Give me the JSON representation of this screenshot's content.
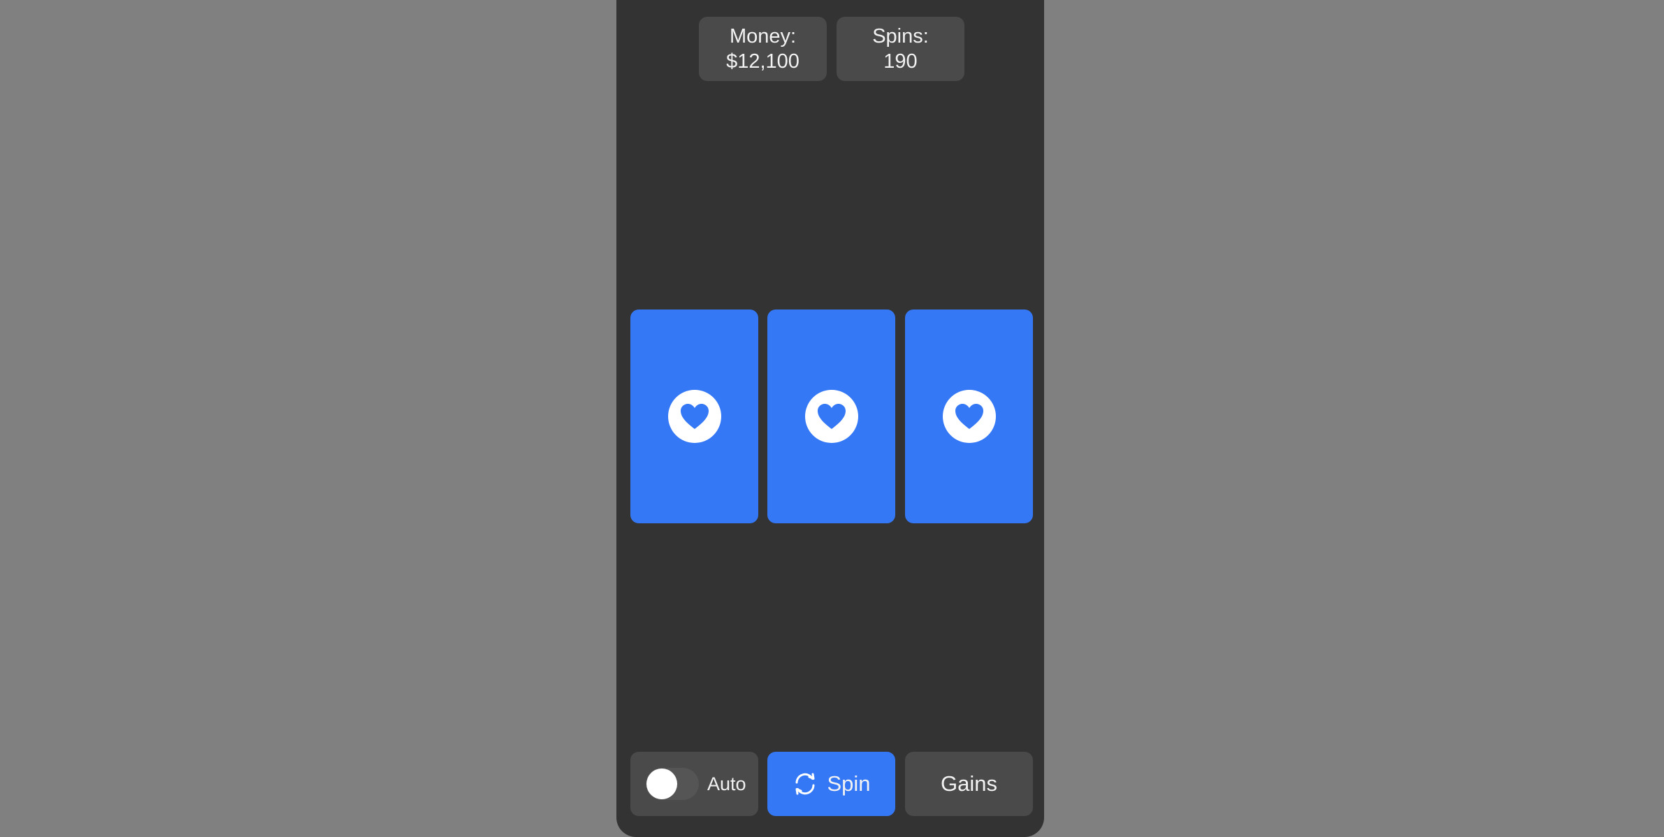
{
  "stats": {
    "money_label": "Money:",
    "money_value": "$12,100",
    "spins_label": "Spins:",
    "spins_value": "190"
  },
  "reels": [
    {
      "symbol": "heart-icon"
    },
    {
      "symbol": "heart-icon"
    },
    {
      "symbol": "heart-icon"
    }
  ],
  "controls": {
    "auto_label": "Auto",
    "auto_enabled": false,
    "spin_label": "Spin",
    "spin_icon": "refresh-icon",
    "gains_label": "Gains"
  },
  "colors": {
    "background": "#808080",
    "panel": "#333333",
    "card": "#4a4a4a",
    "accent": "#3578f6",
    "text": "#f2f2f2"
  }
}
